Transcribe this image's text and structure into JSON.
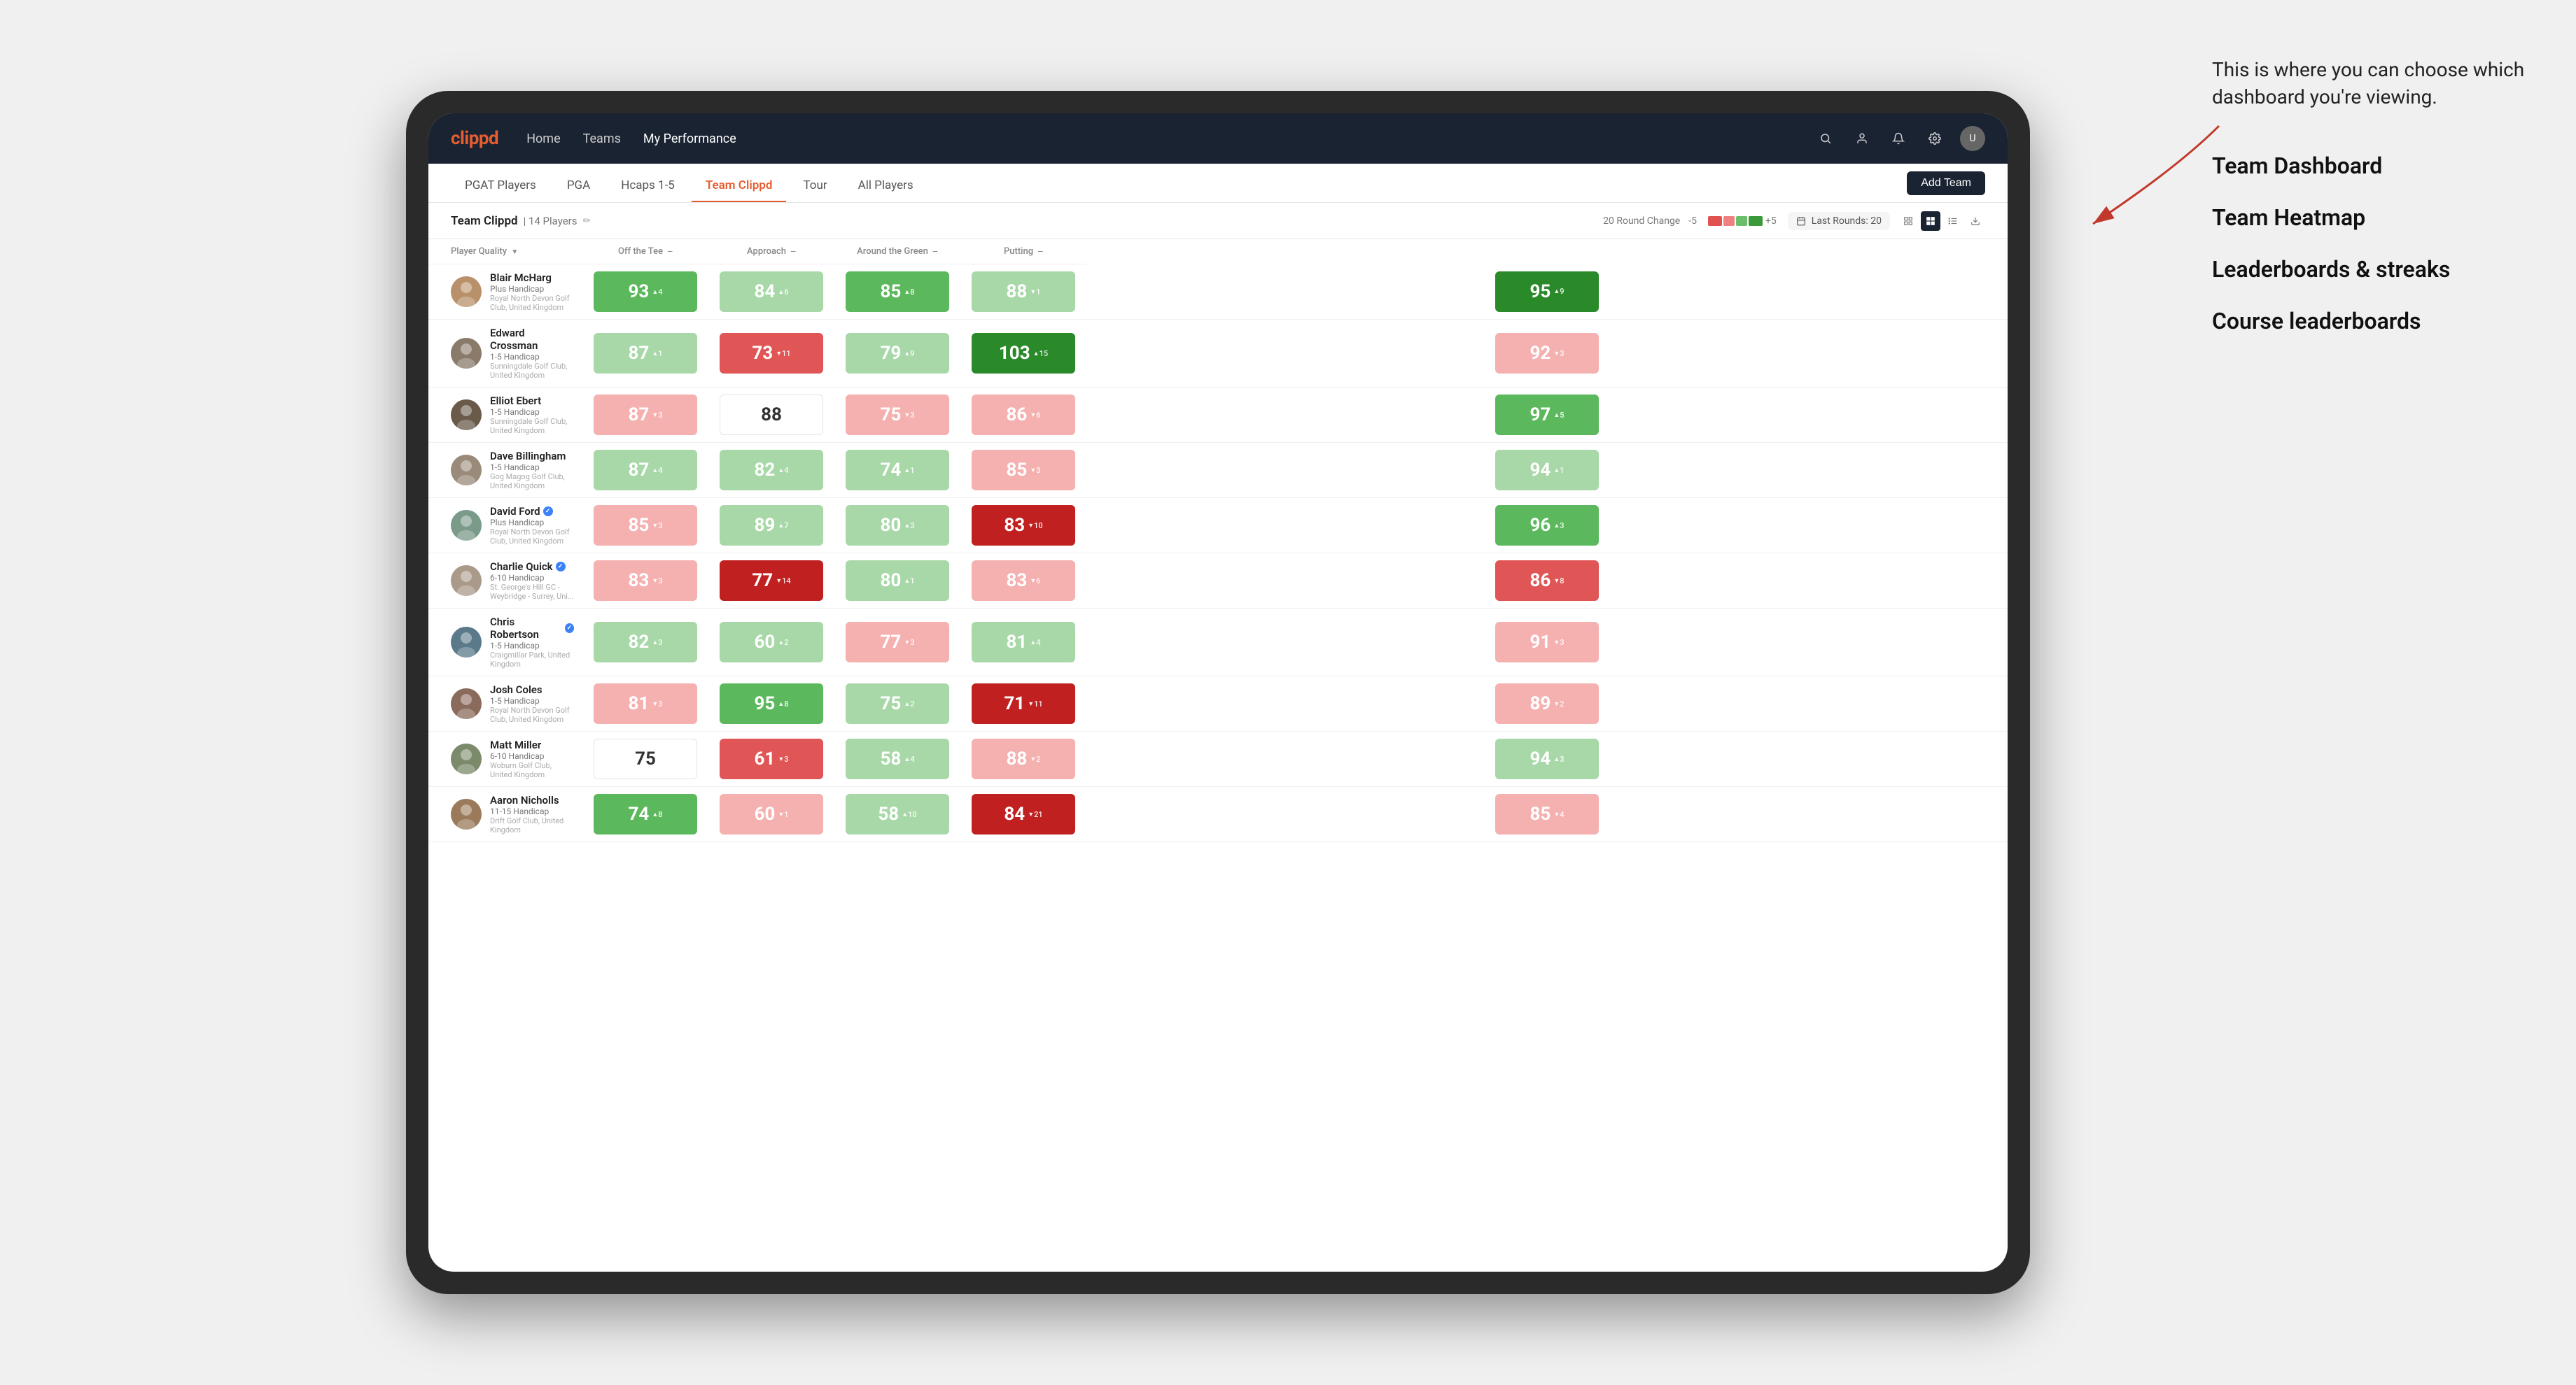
{
  "annotation": {
    "intro": "This is where you can choose which dashboard you're viewing.",
    "items": [
      "Team Dashboard",
      "Team Heatmap",
      "Leaderboards & streaks",
      "Course leaderboards"
    ]
  },
  "nav": {
    "logo": "clippd",
    "links": [
      "Home",
      "Teams",
      "My Performance"
    ],
    "active_link": "My Performance"
  },
  "tabs": {
    "items": [
      "PGAT Players",
      "PGA",
      "Hcaps 1-5",
      "Team Clippd",
      "Tour",
      "All Players"
    ],
    "active": "Team Clippd"
  },
  "add_team_label": "Add Team",
  "team_header": {
    "name": "Team Clippd",
    "separator": "|",
    "count": "14 Players",
    "round_change_label": "20 Round Change",
    "change_minus": "-5",
    "change_plus": "+5",
    "last_rounds_label": "Last Rounds:",
    "last_rounds_value": "20"
  },
  "table": {
    "columns": [
      {
        "key": "player",
        "label": "Player Quality",
        "sortable": true
      },
      {
        "key": "off_tee",
        "label": "Off the Tee",
        "sortable": true
      },
      {
        "key": "approach",
        "label": "Approach",
        "sortable": true
      },
      {
        "key": "around_green",
        "label": "Around the Green",
        "sortable": true
      },
      {
        "key": "putting",
        "label": "Putting",
        "sortable": true
      }
    ],
    "rows": [
      {
        "name": "Blair McHarg",
        "handicap": "Plus Handicap",
        "club": "Royal North Devon Golf Club, United Kingdom",
        "verified": false,
        "avatar_color": "#b8906a",
        "scores": [
          {
            "val": "93",
            "change": "4",
            "dir": "up",
            "bg": "green-mid"
          },
          {
            "val": "84",
            "change": "6",
            "dir": "up",
            "bg": "green-light"
          },
          {
            "val": "85",
            "change": "8",
            "dir": "up",
            "bg": "green-mid"
          },
          {
            "val": "88",
            "change": "1",
            "dir": "down",
            "bg": "green-light"
          },
          {
            "val": "95",
            "change": "9",
            "dir": "up",
            "bg": "green-dark"
          }
        ]
      },
      {
        "name": "Edward Crossman",
        "handicap": "1-5 Handicap",
        "club": "Sunningdale Golf Club, United Kingdom",
        "verified": false,
        "avatar_color": "#8a7a6a",
        "scores": [
          {
            "val": "87",
            "change": "1",
            "dir": "up",
            "bg": "green-light"
          },
          {
            "val": "73",
            "change": "11",
            "dir": "down",
            "bg": "red-mid"
          },
          {
            "val": "79",
            "change": "9",
            "dir": "up",
            "bg": "green-light"
          },
          {
            "val": "103",
            "change": "15",
            "dir": "up",
            "bg": "green-dark"
          },
          {
            "val": "92",
            "change": "3",
            "dir": "down",
            "bg": "red-light"
          }
        ]
      },
      {
        "name": "Elliot Ebert",
        "handicap": "1-5 Handicap",
        "club": "Sunningdale Golf Club, United Kingdom",
        "verified": false,
        "avatar_color": "#6a5a4a",
        "scores": [
          {
            "val": "87",
            "change": "3",
            "dir": "down",
            "bg": "red-light"
          },
          {
            "val": "88",
            "change": "",
            "dir": "",
            "bg": "white"
          },
          {
            "val": "75",
            "change": "3",
            "dir": "down",
            "bg": "red-light"
          },
          {
            "val": "86",
            "change": "6",
            "dir": "down",
            "bg": "red-light"
          },
          {
            "val": "97",
            "change": "5",
            "dir": "up",
            "bg": "green-mid"
          }
        ]
      },
      {
        "name": "Dave Billingham",
        "handicap": "1-5 Handicap",
        "club": "Gog Magog Golf Club, United Kingdom",
        "verified": false,
        "avatar_color": "#9a8a7a",
        "scores": [
          {
            "val": "87",
            "change": "4",
            "dir": "up",
            "bg": "green-light"
          },
          {
            "val": "82",
            "change": "4",
            "dir": "up",
            "bg": "green-light"
          },
          {
            "val": "74",
            "change": "1",
            "dir": "up",
            "bg": "green-light"
          },
          {
            "val": "85",
            "change": "3",
            "dir": "down",
            "bg": "red-light"
          },
          {
            "val": "94",
            "change": "1",
            "dir": "up",
            "bg": "green-light"
          }
        ]
      },
      {
        "name": "David Ford",
        "handicap": "Plus Handicap",
        "club": "Royal North Devon Golf Club, United Kingdom",
        "verified": true,
        "avatar_color": "#7a9a8a",
        "scores": [
          {
            "val": "85",
            "change": "3",
            "dir": "down",
            "bg": "red-light"
          },
          {
            "val": "89",
            "change": "7",
            "dir": "up",
            "bg": "green-light"
          },
          {
            "val": "80",
            "change": "3",
            "dir": "up",
            "bg": "green-light"
          },
          {
            "val": "83",
            "change": "10",
            "dir": "down",
            "bg": "red-dark"
          },
          {
            "val": "96",
            "change": "3",
            "dir": "up",
            "bg": "green-mid"
          }
        ]
      },
      {
        "name": "Charlie Quick",
        "handicap": "6-10 Handicap",
        "club": "St. George's Hill GC - Weybridge - Surrey, Uni...",
        "verified": true,
        "avatar_color": "#aa9a8a",
        "scores": [
          {
            "val": "83",
            "change": "3",
            "dir": "down",
            "bg": "red-light"
          },
          {
            "val": "77",
            "change": "14",
            "dir": "down",
            "bg": "red-dark"
          },
          {
            "val": "80",
            "change": "1",
            "dir": "up",
            "bg": "green-light"
          },
          {
            "val": "83",
            "change": "6",
            "dir": "down",
            "bg": "red-light"
          },
          {
            "val": "86",
            "change": "8",
            "dir": "down",
            "bg": "red-mid"
          }
        ]
      },
      {
        "name": "Chris Robertson",
        "handicap": "1-5 Handicap",
        "club": "Craigmillar Park, United Kingdom",
        "verified": true,
        "avatar_color": "#5a7a8a",
        "scores": [
          {
            "val": "82",
            "change": "3",
            "dir": "up",
            "bg": "green-light"
          },
          {
            "val": "60",
            "change": "2",
            "dir": "up",
            "bg": "green-light"
          },
          {
            "val": "77",
            "change": "3",
            "dir": "down",
            "bg": "red-light"
          },
          {
            "val": "81",
            "change": "4",
            "dir": "up",
            "bg": "green-light"
          },
          {
            "val": "91",
            "change": "3",
            "dir": "down",
            "bg": "red-light"
          }
        ]
      },
      {
        "name": "Josh Coles",
        "handicap": "1-5 Handicap",
        "club": "Royal North Devon Golf Club, United Kingdom",
        "verified": false,
        "avatar_color": "#8a6a5a",
        "scores": [
          {
            "val": "81",
            "change": "3",
            "dir": "down",
            "bg": "red-light"
          },
          {
            "val": "95",
            "change": "8",
            "dir": "up",
            "bg": "green-mid"
          },
          {
            "val": "75",
            "change": "2",
            "dir": "up",
            "bg": "green-light"
          },
          {
            "val": "71",
            "change": "11",
            "dir": "down",
            "bg": "red-dark"
          },
          {
            "val": "89",
            "change": "2",
            "dir": "down",
            "bg": "red-light"
          }
        ]
      },
      {
        "name": "Matt Miller",
        "handicap": "6-10 Handicap",
        "club": "Woburn Golf Club, United Kingdom",
        "verified": false,
        "avatar_color": "#7a8a6a",
        "scores": [
          {
            "val": "75",
            "change": "",
            "dir": "",
            "bg": "white"
          },
          {
            "val": "61",
            "change": "3",
            "dir": "down",
            "bg": "red-mid"
          },
          {
            "val": "58",
            "change": "4",
            "dir": "up",
            "bg": "green-light"
          },
          {
            "val": "88",
            "change": "2",
            "dir": "down",
            "bg": "red-light"
          },
          {
            "val": "94",
            "change": "3",
            "dir": "up",
            "bg": "green-light"
          }
        ]
      },
      {
        "name": "Aaron Nicholls",
        "handicap": "11-15 Handicap",
        "club": "Drift Golf Club, United Kingdom",
        "verified": false,
        "avatar_color": "#9a7a5a",
        "scores": [
          {
            "val": "74",
            "change": "8",
            "dir": "up",
            "bg": "green-mid"
          },
          {
            "val": "60",
            "change": "1",
            "dir": "down",
            "bg": "red-light"
          },
          {
            "val": "58",
            "change": "10",
            "dir": "up",
            "bg": "green-light"
          },
          {
            "val": "84",
            "change": "21",
            "dir": "down",
            "bg": "red-dark"
          },
          {
            "val": "85",
            "change": "4",
            "dir": "down",
            "bg": "red-light"
          }
        ]
      }
    ]
  }
}
